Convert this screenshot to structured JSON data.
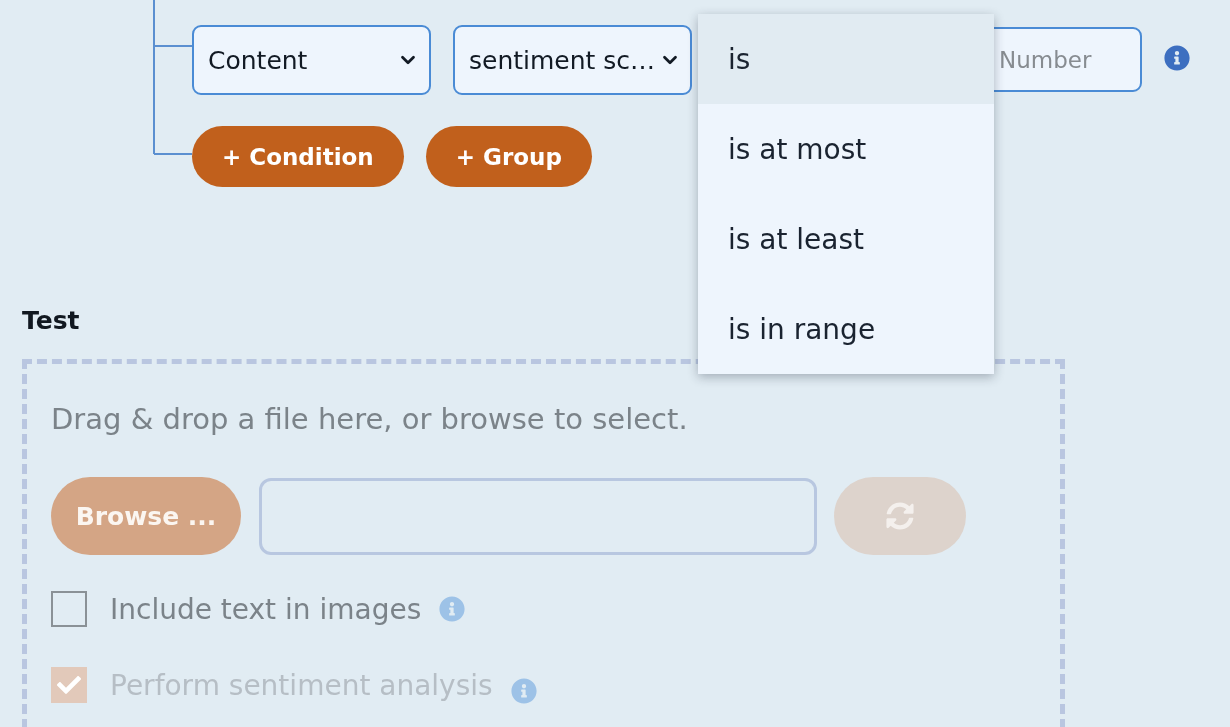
{
  "condition_tree": {
    "condition": {
      "field": {
        "value": "Content"
      },
      "property": {
        "value": "sentiment sc…"
      },
      "operator": {
        "expanded": true,
        "options": [
          {
            "label": "is",
            "selected": true
          },
          {
            "label": "is at most",
            "selected": false
          },
          {
            "label": "is at least",
            "selected": false
          },
          {
            "label": "is in range",
            "selected": false
          }
        ]
      },
      "value": {
        "placeholder": "Number"
      }
    },
    "buttons": [
      {
        "label": "+ Condition"
      },
      {
        "label": "+ Group"
      }
    ]
  },
  "test": {
    "title": "Test",
    "dropzone": {
      "hint": "Drag & drop a file here, or browse to select.",
      "browse_button": {
        "label": "Browse ...",
        "disabled": true
      },
      "refresh_button": {
        "disabled": true
      },
      "options": [
        {
          "label": "Include text in images",
          "checked": false,
          "disabled": false
        },
        {
          "label": "Perform sentiment analysis",
          "checked": true,
          "disabled": true
        }
      ]
    }
  }
}
